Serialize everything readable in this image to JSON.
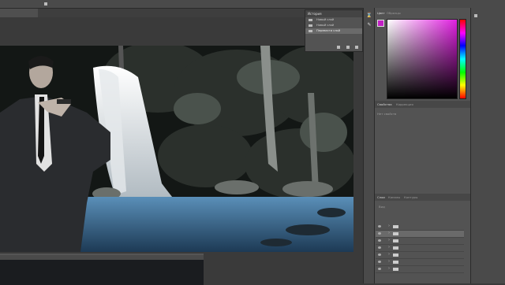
{
  "app": {
    "options_bar": {
      "items": [
        "",
        "",
        ""
      ]
    },
    "document_tab": {
      "title": ""
    }
  },
  "history_panel": {
    "title": "История",
    "items": [
      {
        "label": "Новый слой"
      },
      {
        "label": "Новый слой"
      },
      {
        "label": "Перевести слой"
      }
    ]
  },
  "color_panel": {
    "tabs": [
      "Цвет",
      "Образцы"
    ],
    "foreground_color": "#c220c4",
    "background_color": "#ffffff"
  },
  "adjustments_panel": {
    "tabs": [
      "Свойства",
      "Коррекция"
    ],
    "subtitle": "Нет свойств"
  },
  "layers_panel": {
    "tabs": [
      "Слои",
      "Каналы",
      "Контуры"
    ],
    "filter_label": "Вид",
    "rows": [
      {
        "name": ""
      },
      {
        "name": ""
      },
      {
        "name": ""
      },
      {
        "name": ""
      },
      {
        "name": ""
      },
      {
        "name": ""
      },
      {
        "name": ""
      },
      {
        "name": ""
      }
    ]
  },
  "far_right_panel": {
    "title": ""
  },
  "bottom_document": {
    "title": ""
  }
}
